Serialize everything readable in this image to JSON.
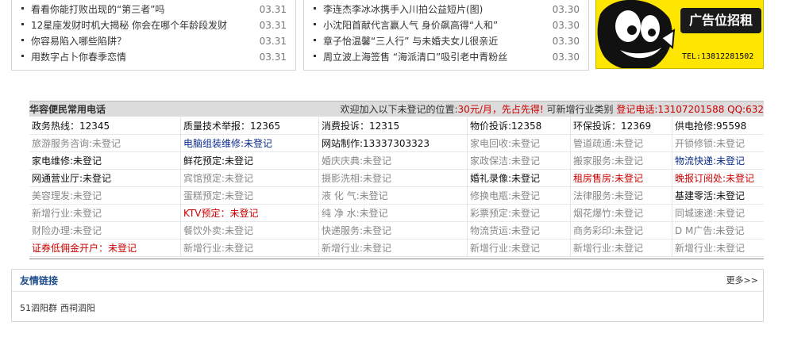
{
  "news_left": [
    {
      "title": "看看你能打败出现的“第三者”吗",
      "date": "03.31"
    },
    {
      "title": "12星座发财时机大揭秘 你会在哪个年龄段发财",
      "date": "03.31"
    },
    {
      "title": "你容易陷入哪些陷阱？",
      "date": "03.31"
    },
    {
      "title": "用数字占卜你春季恋情",
      "date": "03.31"
    }
  ],
  "news_mid": [
    {
      "title": "李连杰李冰冰携手入川拍公益短片(图)",
      "date": "03.30"
    },
    {
      "title": "小沈阳首献代言赢人气 身价飙高得“人和”",
      "date": "03.30"
    },
    {
      "title": "章子怡温馨“三人行” 与未婚夫女儿很亲近",
      "date": "03.30"
    },
    {
      "title": "周立波上海签售 “海派清口”吸引老中青粉丝",
      "date": "03.30"
    }
  ],
  "ad": {
    "text": "广告位招租",
    "tel": "TEL:13812281502"
  },
  "colors": {
    "ad_bg": "#ffe600",
    "red": "#cc0000",
    "blue": "#0a2d8a",
    "link_title": "#1f4e8c"
  },
  "phones": {
    "title": "华容便民常用电话",
    "notice_prefix": "欢迎加入以下未登记的位置:",
    "notice_price": "30元/月，先占先得!",
    "notice_mid": "  可新增行业类别 ",
    "notice_contact": "登记电话:13107201588 QQ:632",
    "rows": [
      [
        {
          "text": "政务热线：12345",
          "style": "black"
        },
        {
          "text": "质量技术举报：12365",
          "style": "black"
        },
        {
          "text": "消费投诉：12315",
          "style": "black"
        },
        {
          "text": "物价投诉:12358",
          "style": "black"
        },
        {
          "text": "环保投诉：12369",
          "style": "black"
        },
        {
          "text": "供电抢修:95598",
          "style": "black"
        }
      ],
      [
        {
          "text": "旅游服务咨询:未登记",
          "style": "gray"
        },
        {
          "text": "电脑组装维修:未登记",
          "style": "blue"
        },
        {
          "text": "网站制作:13337303323",
          "style": "black"
        },
        {
          "text": "家电回收:未登记",
          "style": "gray"
        },
        {
          "text": "管道疏通:未登记",
          "style": "gray"
        },
        {
          "text": "开锁修锁:未登记",
          "style": "gray"
        }
      ],
      [
        {
          "text": "家电维修:未登记",
          "style": "black"
        },
        {
          "text": "鲜花预定:未登记",
          "style": "black"
        },
        {
          "text": "婚庆庆典:未登记",
          "style": "gray"
        },
        {
          "text": "家政保洁:未登记",
          "style": "gray"
        },
        {
          "text": "搬家服务:未登记",
          "style": "gray"
        },
        {
          "text": "物流快递:未登记",
          "style": "blue"
        }
      ],
      [
        {
          "text": "网通营业厅:未登记",
          "style": "black"
        },
        {
          "text": "宾馆预定:未登记",
          "style": "gray"
        },
        {
          "text": "摄影洗相:未登记",
          "style": "gray"
        },
        {
          "text": "婚礼录像:未登记",
          "style": "black"
        },
        {
          "text": "租房售房:未登记",
          "style": "red"
        },
        {
          "text": "晚报订阅处:未登记",
          "style": "red"
        }
      ],
      [
        {
          "text": "美容理发:未登记",
          "style": "gray"
        },
        {
          "text": "蛋糕预定:未登记",
          "style": "gray"
        },
        {
          "text": "液 化 气:未登记",
          "style": "gray"
        },
        {
          "text": "修换电瓶:未登记",
          "style": "gray"
        },
        {
          "text": "法律服务:未登记",
          "style": "gray"
        },
        {
          "text": "基建零活:未登记",
          "style": "black"
        }
      ],
      [
        {
          "text": "新增行业:未登记",
          "style": "gray"
        },
        {
          "text": "KTV预定：未登记",
          "style": "red"
        },
        {
          "text": "纯 净 水:未登记",
          "style": "gray"
        },
        {
          "text": "彩票预定:未登记",
          "style": "gray"
        },
        {
          "text": "烟花爆竹:未登记",
          "style": "gray"
        },
        {
          "text": "同城速递:未登记",
          "style": "gray"
        }
      ],
      [
        {
          "text": "财险办理:未登记",
          "style": "gray"
        },
        {
          "text": "餐饮外卖:未登记",
          "style": "gray"
        },
        {
          "text": "快递服务:未登记",
          "style": "gray"
        },
        {
          "text": "物流货运:未登记",
          "style": "gray"
        },
        {
          "text": "商务彩印:未登记",
          "style": "gray"
        },
        {
          "text": "D M广告:未登记",
          "style": "gray"
        }
      ],
      [
        {
          "text": "证券低佣金开户：未登记",
          "style": "red"
        },
        {
          "text": "新增行业:未登记",
          "style": "gray"
        },
        {
          "text": "新增行业:未登记",
          "style": "gray"
        },
        {
          "text": "新增行业:未登记",
          "style": "gray"
        },
        {
          "text": "新增行业:未登记",
          "style": "gray"
        },
        {
          "text": "新增行业:未登记",
          "style": "gray"
        }
      ]
    ]
  },
  "links": {
    "title": "友情链接",
    "more": "更多>>",
    "items": [
      "51泗阳群",
      "西祠泗阳"
    ]
  }
}
